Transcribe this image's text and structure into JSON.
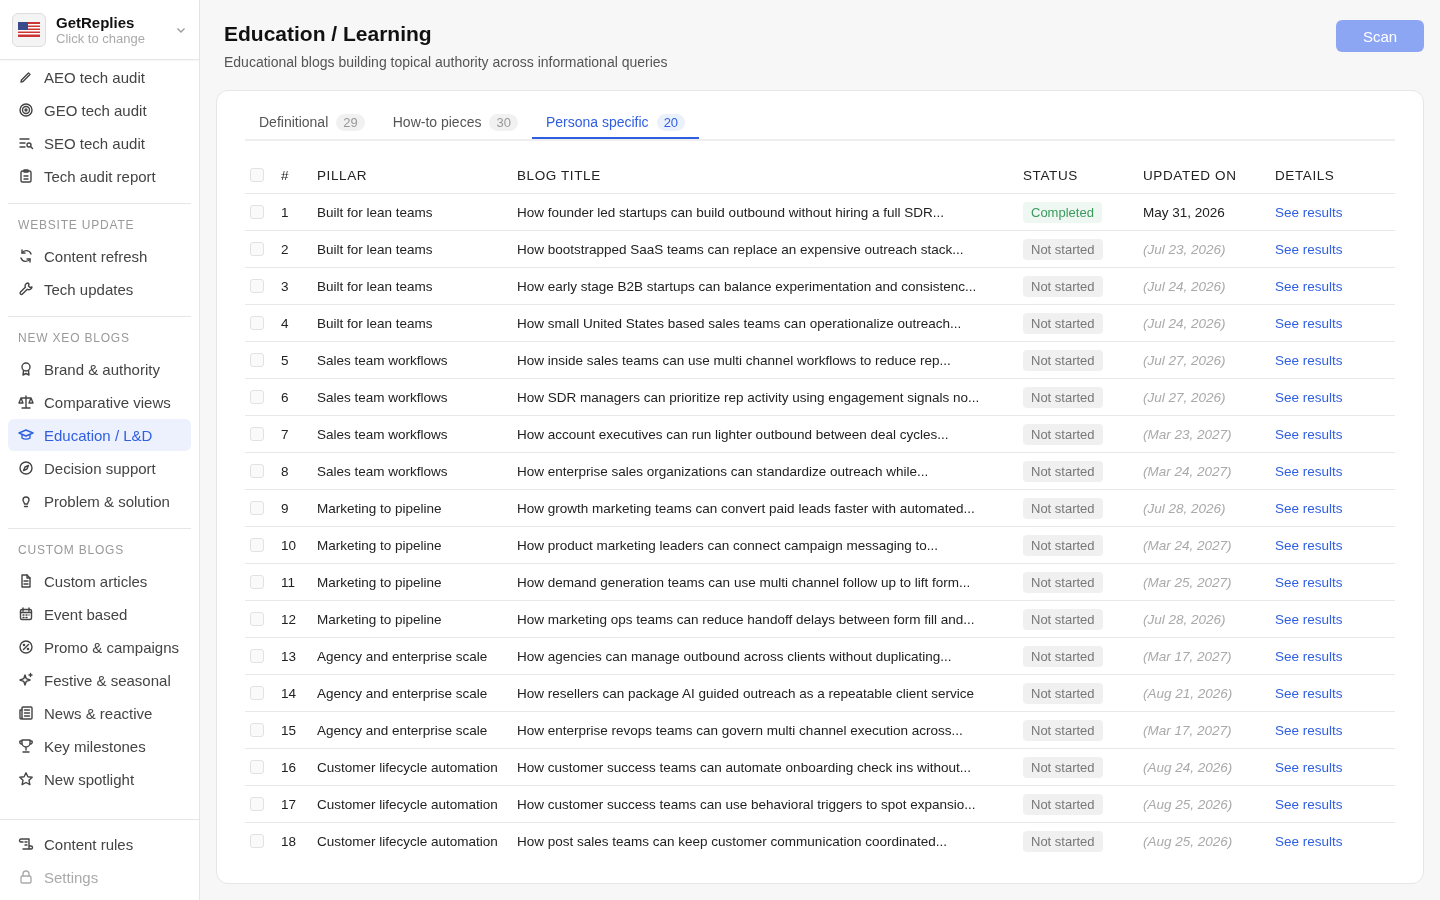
{
  "sidebar": {
    "account": {
      "name": "GetReplies",
      "hint": "Click to change"
    },
    "sections": [
      {
        "items": [
          {
            "label": "AEO tech audit",
            "selected": false,
            "disabled": false
          },
          {
            "label": "GEO tech audit",
            "selected": false,
            "disabled": false
          },
          {
            "label": "SEO tech audit",
            "selected": false,
            "disabled": false
          },
          {
            "label": "Tech audit report",
            "selected": false,
            "disabled": false
          }
        ]
      },
      {
        "heading": "WEBSITE UPDATE",
        "items": [
          {
            "label": "Content refresh",
            "selected": false,
            "disabled": false
          },
          {
            "label": "Tech updates",
            "selected": false,
            "disabled": false
          }
        ]
      },
      {
        "heading": "NEW XEO BLOGS",
        "items": [
          {
            "label": "Brand & authority",
            "selected": false,
            "disabled": false
          },
          {
            "label": "Comparative views",
            "selected": false,
            "disabled": false
          },
          {
            "label": "Education / L&D",
            "selected": true,
            "disabled": false
          },
          {
            "label": "Decision support",
            "selected": false,
            "disabled": false
          },
          {
            "label": "Problem & solution",
            "selected": false,
            "disabled": false
          }
        ]
      },
      {
        "heading": "CUSTOM BLOGS",
        "items": [
          {
            "label": "Custom articles",
            "selected": false,
            "disabled": false
          },
          {
            "label": "Event based",
            "selected": false,
            "disabled": false
          },
          {
            "label": "Promo & campaigns",
            "selected": false,
            "disabled": false
          },
          {
            "label": "Festive & seasonal",
            "selected": false,
            "disabled": false
          },
          {
            "label": "News & reactive",
            "selected": false,
            "disabled": false
          },
          {
            "label": "Key milestones",
            "selected": false,
            "disabled": false
          },
          {
            "label": "New spotlight",
            "selected": false,
            "disabled": false
          }
        ]
      }
    ],
    "footer_items": [
      {
        "label": "Content rules",
        "selected": false,
        "disabled": false
      },
      {
        "label": "Settings",
        "selected": false,
        "disabled": true
      }
    ]
  },
  "page": {
    "title": "Education / Learning",
    "subtitle": "Educational blogs building topical authority across informational queries",
    "scan_button": "Scan"
  },
  "tabs": [
    {
      "label": "Definitional",
      "count": "29",
      "selected": false
    },
    {
      "label": "How-to pieces",
      "count": "30",
      "selected": false
    },
    {
      "label": "Persona specific",
      "count": "20",
      "selected": true
    }
  ],
  "table": {
    "select_all_checked": false,
    "columns": [
      "#",
      "PILLAR",
      "BLOG TITLE",
      "STATUS",
      "UPDATED ON",
      "DETAILS"
    ],
    "rows": [
      {
        "checked": false,
        "number": "1",
        "pillar": "Built for lean teams",
        "title": "How founder led startups can build outbound without hiring a full SDR...",
        "status": {
          "label": "Completed",
          "kind": "completed"
        },
        "updated": "May 31, 2026",
        "details": "See results"
      },
      {
        "checked": false,
        "number": "2",
        "pillar": "Built for lean teams",
        "title": "How bootstrapped SaaS teams can replace an expensive outreach stack...",
        "status": {
          "label": "Not started",
          "kind": "pending"
        },
        "updated": "(Jul 23, 2026)",
        "details": "See results"
      },
      {
        "checked": false,
        "number": "3",
        "pillar": "Built for lean teams",
        "title": "How early stage B2B startups can balance experimentation and consistenc...",
        "status": {
          "label": "Not started",
          "kind": "pending"
        },
        "updated": "(Jul 24, 2026)",
        "details": "See results"
      },
      {
        "checked": false,
        "number": "4",
        "pillar": "Built for lean teams",
        "title": "How small United States based sales teams can operationalize outreach...",
        "status": {
          "label": "Not started",
          "kind": "pending"
        },
        "updated": "(Jul 24, 2026)",
        "details": "See results"
      },
      {
        "checked": false,
        "number": "5",
        "pillar": "Sales team workflows",
        "title": "How inside sales teams can use multi channel workflows to reduce rep...",
        "status": {
          "label": "Not started",
          "kind": "pending"
        },
        "updated": "(Jul 27, 2026)",
        "details": "See results"
      },
      {
        "checked": false,
        "number": "6",
        "pillar": "Sales team workflows",
        "title": "How SDR managers can prioritize rep activity using engagement signals no...",
        "status": {
          "label": "Not started",
          "kind": "pending"
        },
        "updated": "(Jul 27, 2026)",
        "details": "See results"
      },
      {
        "checked": false,
        "number": "7",
        "pillar": "Sales team workflows",
        "title": "How account executives can run lighter outbound between deal cycles...",
        "status": {
          "label": "Not started",
          "kind": "pending"
        },
        "updated": "(Mar 23, 2027)",
        "details": "See results"
      },
      {
        "checked": false,
        "number": "8",
        "pillar": "Sales team workflows",
        "title": "How enterprise sales organizations can standardize outreach while...",
        "status": {
          "label": "Not started",
          "kind": "pending"
        },
        "updated": "(Mar 24, 2027)",
        "details": "See results"
      },
      {
        "checked": false,
        "number": "9",
        "pillar": "Marketing to pipeline",
        "title": "How growth marketing teams can convert paid leads faster with automated...",
        "status": {
          "label": "Not started",
          "kind": "pending"
        },
        "updated": "(Jul 28, 2026)",
        "details": "See results"
      },
      {
        "checked": false,
        "number": "10",
        "pillar": "Marketing to pipeline",
        "title": "How product marketing leaders can connect campaign messaging to...",
        "status": {
          "label": "Not started",
          "kind": "pending"
        },
        "updated": "(Mar 24, 2027)",
        "details": "See results"
      },
      {
        "checked": false,
        "number": "11",
        "pillar": "Marketing to pipeline",
        "title": "How demand generation teams can use multi channel follow up to lift form...",
        "status": {
          "label": "Not started",
          "kind": "pending"
        },
        "updated": "(Mar 25, 2027)",
        "details": "See results"
      },
      {
        "checked": false,
        "number": "12",
        "pillar": "Marketing to pipeline",
        "title": "How marketing ops teams can reduce handoff delays between form fill and...",
        "status": {
          "label": "Not started",
          "kind": "pending"
        },
        "updated": "(Jul 28, 2026)",
        "details": "See results"
      },
      {
        "checked": false,
        "number": "13",
        "pillar": "Agency and enterprise scale",
        "title": "How agencies can manage outbound across clients without duplicating...",
        "status": {
          "label": "Not started",
          "kind": "pending"
        },
        "updated": "(Mar 17, 2027)",
        "details": "See results"
      },
      {
        "checked": false,
        "number": "14",
        "pillar": "Agency and enterprise scale",
        "title": "How resellers can package AI guided outreach as a repeatable client service",
        "status": {
          "label": "Not started",
          "kind": "pending"
        },
        "updated": "(Aug 21, 2026)",
        "details": "See results"
      },
      {
        "checked": false,
        "number": "15",
        "pillar": "Agency and enterprise scale",
        "title": "How enterprise revops teams can govern multi channel execution across...",
        "status": {
          "label": "Not started",
          "kind": "pending"
        },
        "updated": "(Mar 17, 2027)",
        "details": "See results"
      },
      {
        "checked": false,
        "number": "16",
        "pillar": "Customer lifecycle automation",
        "title": "How customer success teams can automate onboarding check ins without...",
        "status": {
          "label": "Not started",
          "kind": "pending"
        },
        "updated": "(Aug 24, 2026)",
        "details": "See results"
      },
      {
        "checked": false,
        "number": "17",
        "pillar": "Customer lifecycle automation",
        "title": "How customer success teams can use behavioral triggers to spot expansio...",
        "status": {
          "label": "Not started",
          "kind": "pending"
        },
        "updated": "(Aug 25, 2026)",
        "details": "See results"
      },
      {
        "checked": false,
        "number": "18",
        "pillar": "Customer lifecycle automation",
        "title": "How post sales teams can keep customer communication coordinated...",
        "status": {
          "label": "Not started",
          "kind": "pending"
        },
        "updated": "(Aug 25, 2026)",
        "details": "See results"
      }
    ]
  }
}
